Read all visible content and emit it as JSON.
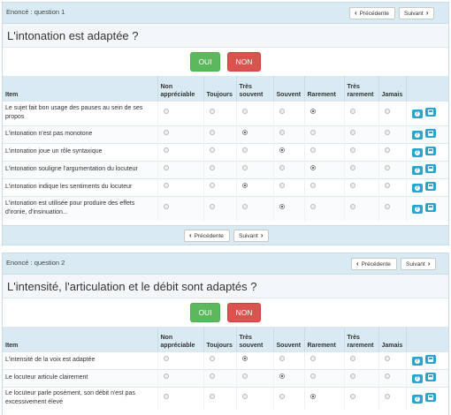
{
  "nav": {
    "prev_label": "Précédente",
    "next_label": "Suivant"
  },
  "answers": {
    "yes_label": "OUI",
    "no_label": "NON"
  },
  "columns": [
    "Item",
    "Non appréciable",
    "Toujours",
    "Très souvent",
    "Souvent",
    "Rarement",
    "Très rarement",
    "Jamais"
  ],
  "questions": [
    {
      "label": "Enoncé : question 1",
      "title": "L'intonation est adaptée ?",
      "rows": [
        {
          "text": "Le sujet fait bon usage des pauses au sein de ses propos",
          "selected": "Rarement"
        },
        {
          "text": "L'intonation n'est pas monotone",
          "selected": "Très souvent"
        },
        {
          "text": "L'intonation joue un rôle syntaxique",
          "selected": "Souvent"
        },
        {
          "text": "L'intonation souligne l'argumentation du locuteur",
          "selected": "Rarement"
        },
        {
          "text": "L'intonation indique les sentiments du locuteur",
          "selected": "Très souvent"
        },
        {
          "text": "L'intonation est utilisée pour produire des effets d'ironie, d'insinuation...",
          "selected": "Souvent"
        }
      ]
    },
    {
      "label": "Enoncé : question 2",
      "title": "L'intensité, l'articulation et le débit sont adaptés ?",
      "rows": [
        {
          "text": "L'intensité de la voix est adaptée",
          "selected": "Très souvent"
        },
        {
          "text": "Le locuteur articule clairement",
          "selected": "Souvent"
        },
        {
          "text": "Le locuteur parle posément, son débit n'est pas excessivement élevé",
          "selected": "Rarement"
        }
      ]
    }
  ],
  "icons": {
    "help": "question-circle-icon",
    "save": "floppy-disk-icon"
  },
  "colors": {
    "header_bg": "#d9eaf3",
    "oui": "#5cb85c",
    "non": "#d9534f",
    "icon_btn": "#2ba3cf"
  }
}
